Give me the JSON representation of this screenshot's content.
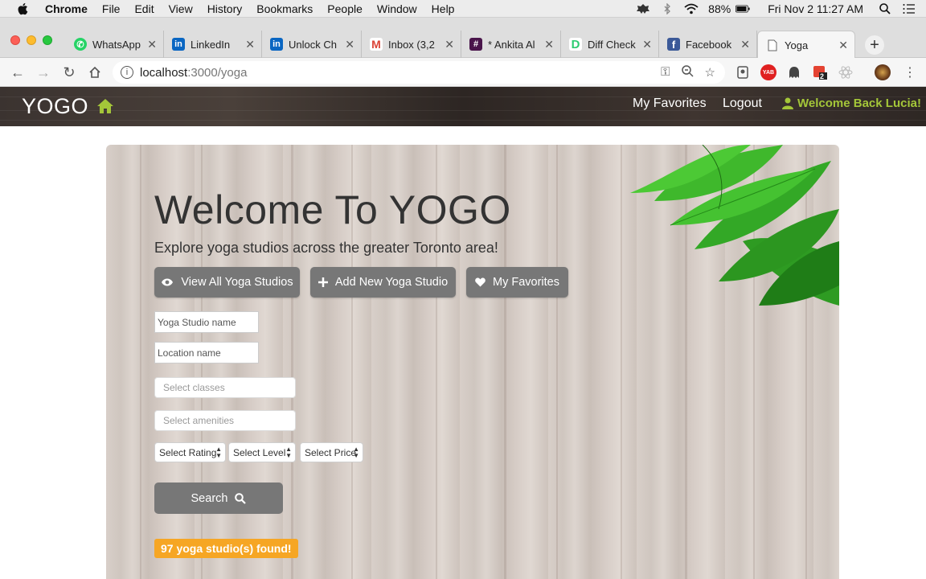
{
  "mac_menubar": {
    "app_name": "Chrome",
    "menus": [
      "File",
      "Edit",
      "View",
      "History",
      "Bookmarks",
      "People",
      "Window",
      "Help"
    ],
    "battery": "88%",
    "clock": "Fri Nov 2  11:27 AM"
  },
  "browser": {
    "tabs": [
      {
        "label": "WhatsApp",
        "icon": "whatsapp-icon",
        "color": "#25d366"
      },
      {
        "label": "LinkedIn",
        "icon": "linkedin-icon",
        "color": "#0a66c2"
      },
      {
        "label": "Unlock Ch",
        "icon": "linkedin-icon",
        "color": "#0a66c2"
      },
      {
        "label": "Inbox (3,2",
        "icon": "gmail-icon",
        "color": "#db4437"
      },
      {
        "label": "* Ankita Al",
        "icon": "slack-icon",
        "color": "#4a154b"
      },
      {
        "label": "Diff Check",
        "icon": "diffchecker-icon",
        "color": "#2ecc71"
      },
      {
        "label": "Facebook",
        "icon": "facebook-icon",
        "color": "#3b5998"
      },
      {
        "label": "Yoga",
        "icon": "page-icon",
        "color": "#888888"
      }
    ],
    "active_tab": "Yoga",
    "url_host": "localhost",
    "url_path": ":3000/yoga",
    "extension_badge": "2"
  },
  "site_nav": {
    "brand": "YOGO",
    "links": [
      "My Favorites",
      "Logout"
    ],
    "welcome": "Welcome Back Lucia!",
    "accent_color": "#a4c639"
  },
  "hero": {
    "title": "Welcome To YOGO",
    "subtitle": "Explore yoga studios across the greater Toronto area!",
    "buttons": [
      {
        "label": "View All Yoga Studios",
        "icon": "eye-icon"
      },
      {
        "label": "Add New Yoga Studio",
        "icon": "plus-icon"
      },
      {
        "label": "My Favorites",
        "icon": "heart-icon"
      }
    ]
  },
  "search_form": {
    "studio_name_placeholder": "Yoga Studio name",
    "location_placeholder": "Location name",
    "classes_placeholder": "Select classes",
    "amenities_placeholder": "Select amenities",
    "rating_select": "Select Rating",
    "level_select": "Select Level",
    "price_select": "Select Price",
    "search_label": "Search"
  },
  "results": {
    "text": "97 yoga studio(s) found!",
    "badge_color": "#f6a624"
  }
}
